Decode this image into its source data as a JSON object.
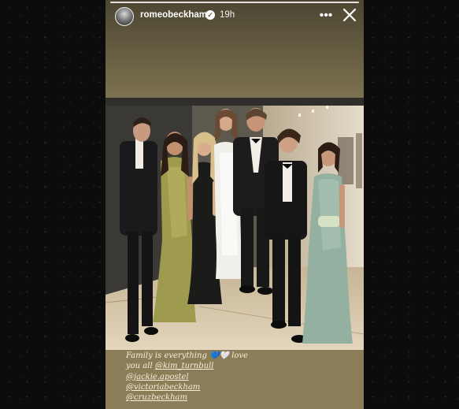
{
  "story": {
    "username": "romeobeckham",
    "verified_badge": "✓",
    "time": "19h",
    "more_label": "•••",
    "caption": {
      "text_1": "Family is everything ",
      "emoji_1": "💙",
      "emoji_2": "🤍",
      "text_2": " love",
      "text_3": "you all ",
      "mentions": [
        "@kim_turnbull",
        "@jackie.apostel",
        "@victoriabeckham",
        "@cruzbeckham"
      ]
    }
  },
  "icons": {
    "more": "more-icon",
    "close": "close-icon",
    "verified": "verified-icon"
  },
  "colors": {
    "story_background": "#7f7452",
    "outer_background": "#0b0b0b",
    "text": "#ffffff"
  }
}
